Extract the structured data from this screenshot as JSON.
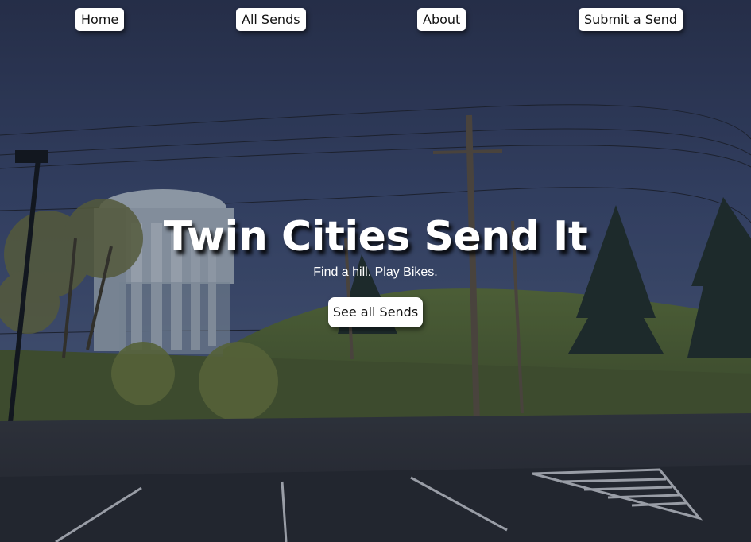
{
  "nav": {
    "home_label": "Home",
    "all_sends_label": "All Sends",
    "about_label": "About",
    "submit_label": "Submit a Send"
  },
  "hero": {
    "title": "Twin Cities Send It",
    "subtitle": "Find a hill. Play Bikes.",
    "cta_label": "See all Sends"
  },
  "colors": {
    "sky_top": "#2b3656",
    "sky_bottom": "#3a4a72",
    "grass": "#556a36",
    "road": "#2a2d33",
    "overlay": "#1c2336"
  }
}
